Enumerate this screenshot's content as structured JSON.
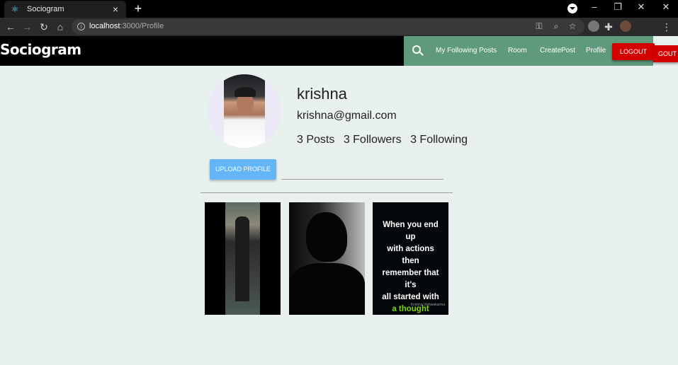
{
  "browser": {
    "tab_title": "Sociogram",
    "url_host": "localhost",
    "url_path": ":3000/Profile"
  },
  "navbar": {
    "brand": "Sociogram",
    "links": [
      "My Following Posts",
      "Room",
      "CreatePost",
      "Profile"
    ],
    "logout_label": "LOGOUT",
    "logout_overflow_label": "GOUT",
    "colors": {
      "bar": "#000000",
      "menu": "#5f9a7c",
      "logout": "#d50000"
    }
  },
  "profile": {
    "name": "krishna",
    "email": "krishna@gmail.com",
    "stats": [
      "3 Posts",
      "3 Followers",
      "3 Following"
    ],
    "upload_label": "UPLOAD PROFILE"
  },
  "gallery": {
    "quote_lines": [
      "When you end up",
      "with actions then",
      "remember that it's",
      "all started with"
    ],
    "quote_highlight": "a thought",
    "quote_author": "- Krishna Vishwakarma",
    "accent_color": "#7cd11a"
  }
}
